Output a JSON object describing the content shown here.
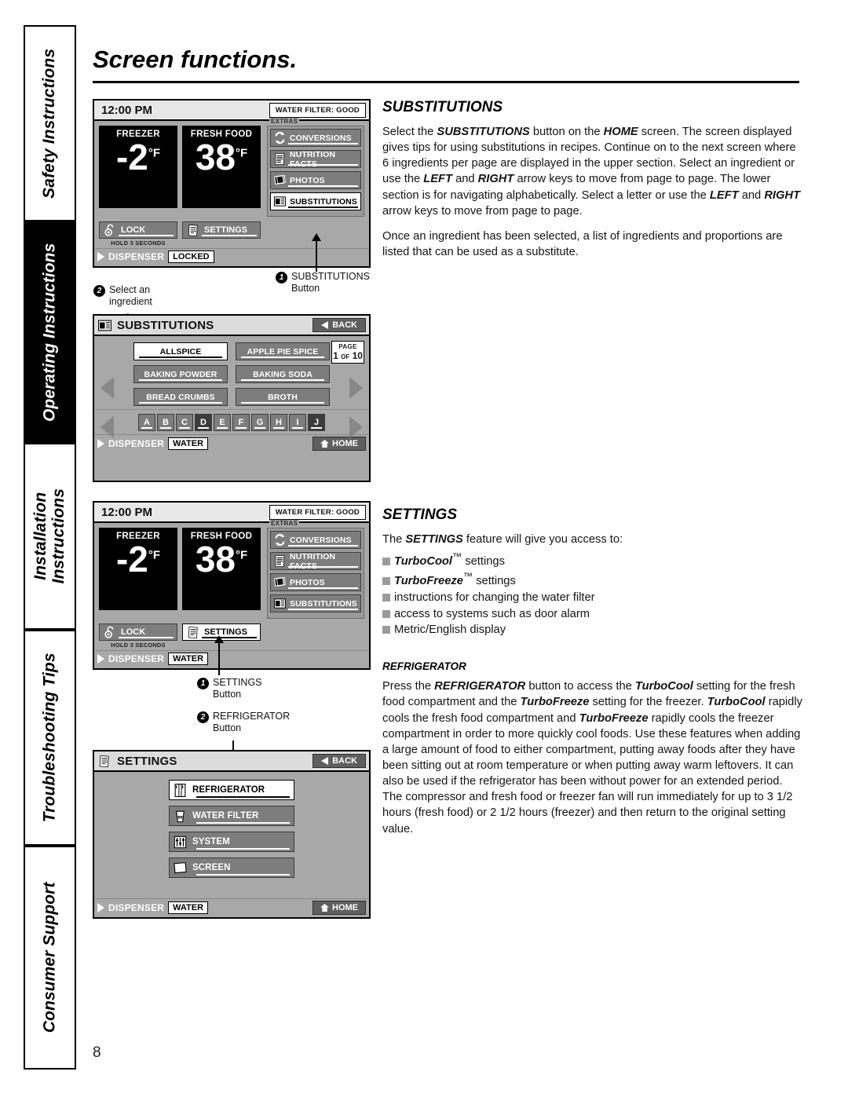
{
  "page": {
    "title": "Screen functions.",
    "number": "8"
  },
  "sidebar": {
    "tabs": [
      {
        "label": "Safety Instructions",
        "active": false
      },
      {
        "label": "Operating Instructions",
        "active": true
      },
      {
        "label": "Installation Instructions",
        "active": false
      },
      {
        "label": "Troubleshooting Tips",
        "active": false
      },
      {
        "label": "Consumer Support",
        "active": false
      }
    ]
  },
  "home_screen_1": {
    "time": "12:00 PM",
    "water_filter": "Water Filter: Good",
    "freezer": {
      "label": "Freezer",
      "value": "-2",
      "unit": "°F"
    },
    "fresh_food": {
      "label": "Fresh Food",
      "value": "38",
      "unit": "°F"
    },
    "extras_caption": "Extras",
    "extras": [
      {
        "label": "Conversions",
        "icon": "conversions-icon",
        "selected": false
      },
      {
        "label": "Nutrition Facts",
        "icon": "nutrition-facts-icon",
        "selected": false
      },
      {
        "label": "Photos",
        "icon": "photos-icon",
        "selected": false
      },
      {
        "label": "Substitutions",
        "icon": "substitutions-icon",
        "selected": true
      }
    ],
    "lock": {
      "label": "Lock",
      "note": "Hold 3 seconds"
    },
    "settings": {
      "label": "Settings",
      "selected": false
    },
    "dispenser": {
      "label": "Dispenser",
      "status": "Locked"
    }
  },
  "home_screen_2": {
    "time": "12:00 PM",
    "water_filter": "Water Filter: Good",
    "freezer": {
      "label": "Freezer",
      "value": "-2",
      "unit": "°F"
    },
    "fresh_food": {
      "label": "Fresh Food",
      "value": "38",
      "unit": "°F"
    },
    "extras_caption": "Extras",
    "extras": [
      {
        "label": "Conversions",
        "icon": "conversions-icon",
        "selected": false
      },
      {
        "label": "Nutrition Facts",
        "icon": "nutrition-facts-icon",
        "selected": false
      },
      {
        "label": "Photos",
        "icon": "photos-icon",
        "selected": false
      },
      {
        "label": "Substitutions",
        "icon": "substitutions-icon",
        "selected": false
      }
    ],
    "lock": {
      "label": "Lock",
      "note": "Hold 3 seconds"
    },
    "settings": {
      "label": "Settings",
      "selected": true
    },
    "dispenser": {
      "label": "Dispenser",
      "status": "Water"
    }
  },
  "substitutions_screen": {
    "title": "Substitutions",
    "back": "Back",
    "page_caption": "Page",
    "page_current": "1",
    "page_of": "of",
    "page_total": "10",
    "ingredients": [
      {
        "label": "Allspice",
        "selected": true
      },
      {
        "label": "Apple Pie Spice",
        "selected": false
      },
      {
        "label": "Baking Powder",
        "selected": false
      },
      {
        "label": "Baking Soda",
        "selected": false
      },
      {
        "label": "Bread Crumbs",
        "selected": false
      },
      {
        "label": "Broth",
        "selected": false
      }
    ],
    "letters": [
      {
        "label": "A",
        "active": false
      },
      {
        "label": "B",
        "active": false
      },
      {
        "label": "C",
        "active": false
      },
      {
        "label": "D",
        "active": true
      },
      {
        "label": "E",
        "active": false
      },
      {
        "label": "F",
        "active": false
      },
      {
        "label": "G",
        "active": false
      },
      {
        "label": "H",
        "active": false
      },
      {
        "label": "I",
        "active": false
      },
      {
        "label": "J",
        "active": true
      }
    ],
    "dispenser": {
      "label": "Dispenser",
      "status": "Water"
    },
    "home": "Home"
  },
  "settings_screen": {
    "title": "Settings",
    "back": "Back",
    "items": [
      {
        "label": "Refrigerator",
        "icon": "refrigerator-icon",
        "selected": true
      },
      {
        "label": "Water Filter",
        "icon": "water-filter-icon",
        "selected": false
      },
      {
        "label": "System",
        "icon": "system-sliders-icon",
        "selected": false
      },
      {
        "label": "Screen",
        "icon": "screen-icon",
        "selected": false
      }
    ],
    "dispenser": {
      "label": "Dispenser",
      "status": "Water"
    },
    "home": "Home"
  },
  "callouts": {
    "substitutions_button": {
      "number": "1",
      "line1": "SUBSTITUTIONS",
      "line2": "Button"
    },
    "select_ingredient": {
      "number": "2",
      "line1": "Select an",
      "line2": "ingredient"
    },
    "settings_button": {
      "number": "1",
      "line1": "SETTINGS",
      "line2": "Button"
    },
    "refrigerator_button": {
      "number": "2",
      "line1": "REFRIGERATOR",
      "line2": "Button"
    }
  },
  "substitutions_text": {
    "heading": "SUBSTITUTIONS",
    "p1_a": "Select the ",
    "p1_b1": "SUBSTITUTIONS",
    "p1_c": " button on the ",
    "p1_b2": "HOME",
    "p1_d": " screen. The screen displayed gives tips for using substitutions in recipes. Continue on to the next screen where 6 ingredients per page are displayed in the upper section. Select an ingredient or use the ",
    "p1_b3": "LEFT",
    "p1_e": " and ",
    "p1_b4": "RIGHT",
    "p1_f": " arrow keys to move from page to page. The lower section is for navigating alphabetically. Select a letter or use the ",
    "p1_b5": "LEFT",
    "p1_g": " and ",
    "p1_b6": "RIGHT",
    "p1_h": " arrow keys to move from page to page.",
    "p2": "Once an ingredient has been selected, a list of ingredients and proportions are listed that can be used as a substitute."
  },
  "settings_text": {
    "heading": "SETTINGS",
    "intro_a": "The ",
    "intro_b": "SETTINGS",
    "intro_c": " feature will give you access to:",
    "bullets": [
      {
        "bold": "TurboCool",
        "sup": "™",
        "rest": " settings"
      },
      {
        "bold": "TurboFreeze",
        "sup": "™",
        "rest": " settings"
      },
      {
        "bold": "",
        "sup": "",
        "rest": "instructions for changing the water filter"
      },
      {
        "bold": "",
        "sup": "",
        "rest": "access to systems such as door alarm"
      },
      {
        "bold": "",
        "sup": "",
        "rest": "Metric/English display"
      }
    ],
    "refrigerator_heading": "REFRIGERATOR",
    "r_a": "Press the ",
    "r_b1": "REFRIGERATOR",
    "r_c": " button to access the ",
    "r_b2": "TurboCool",
    "r_d": " setting for the fresh food compartment and the ",
    "r_b3": "TurboFreeze",
    "r_e": " setting for the freezer. ",
    "r_b4": "TurboCool",
    "r_f": " rapidly cools the fresh food compartment and ",
    "r_b5": "TurboFreeze",
    "r_g": " rapidly cools the freezer compartment in order to more quickly cool foods. Use these features when adding a large amount of food to either compartment, putting away foods after they have been sitting out at room temperature or when putting away warm leftovers. It can also be used if the refrigerator has been without power for an extended period. The compressor and fresh food or freezer fan will run immediately for up to 3 1/2 hours (fresh food) or 2 1/2 hours (freezer) and then return to the original setting value."
  }
}
